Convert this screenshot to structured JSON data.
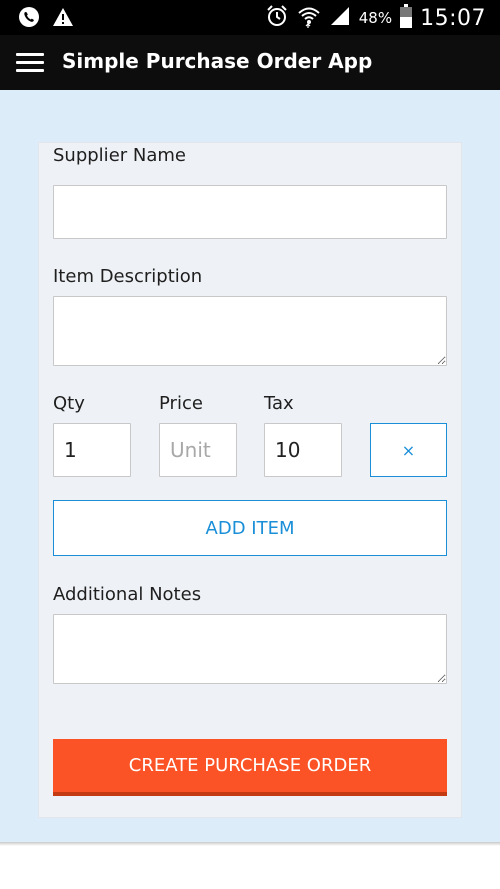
{
  "status_bar": {
    "icons": [
      "phone-icon",
      "warning-icon",
      "alarm-icon",
      "wifi-icon",
      "signal-icon",
      "battery-icon"
    ],
    "battery": "48%",
    "time": "15:07"
  },
  "app_bar": {
    "title": "Simple Purchase Order App",
    "menu_icon": "hamburger-menu-icon"
  },
  "form": {
    "supplier_name": {
      "label": "Supplier Name",
      "value": "",
      "placeholder": ""
    },
    "item_description": {
      "label": "Item Description",
      "value": "",
      "placeholder": ""
    },
    "qty": {
      "label": "Qty",
      "value": "1"
    },
    "price": {
      "label": "Price",
      "value": "",
      "placeholder": "Unit"
    },
    "tax": {
      "label": "Tax",
      "value": "10"
    },
    "remove_label": "×",
    "add_item_label": "ADD ITEM",
    "additional_notes": {
      "label": "Additional Notes",
      "value": "",
      "placeholder": ""
    },
    "create_label": "CREATE PURCHASE ORDER"
  },
  "colors": {
    "status_bar_bg": "#000000",
    "app_bar_bg": "#0d0d0d",
    "page_bg": "#dcecf8",
    "card_bg": "#eef1f5",
    "accent_blue": "#1a8fd8",
    "primary_orange": "#fb5326"
  }
}
